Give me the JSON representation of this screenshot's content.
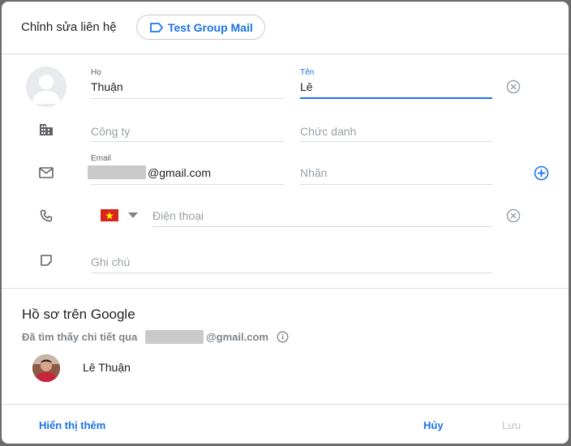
{
  "header": {
    "title": "Chỉnh sửa liên hệ",
    "label_chip": "Test Group Mail"
  },
  "fields": {
    "last_name_label": "Họ",
    "last_name_value": "Thuận",
    "first_name_label": "Tên",
    "first_name_value": "Lê",
    "company_placeholder": "Công ty",
    "job_title_placeholder": "Chức danh",
    "email_label": "Email",
    "email_domain": "@gmail.com",
    "email_label_placeholder": "Nhãn",
    "phone_placeholder": "Điện thoại",
    "note_placeholder": "Ghi chú"
  },
  "google_profile": {
    "title": "Hồ sơ trên Google",
    "found_prefix": "Đã tìm thấy chi tiết qua",
    "found_domain": "@gmail.com",
    "person_name": "Lê Thuận"
  },
  "footer": {
    "show_more": "Hiển thị thêm",
    "cancel": "Hủy",
    "save": "Lưu"
  },
  "colors": {
    "accent": "#1a73e8",
    "disabled": "#bdc1c6",
    "flag_red": "#da251d",
    "flag_star": "#ffff00"
  }
}
